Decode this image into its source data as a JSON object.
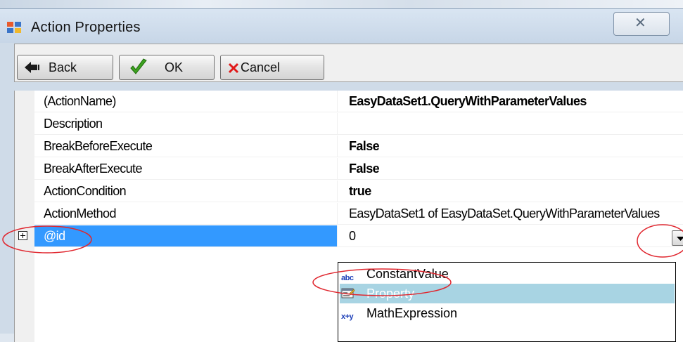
{
  "window": {
    "title": "Action Properties",
    "close_glyph": "✕"
  },
  "toolbar": {
    "back_label": "Back",
    "ok_label": "OK",
    "cancel_label": "Cancel",
    "back_icon": "arrow-left-icon",
    "ok_icon": "checkmark-icon",
    "cancel_icon": "x-icon"
  },
  "properties": [
    {
      "name": "(ActionName)",
      "value": "EasyDataSet1.QueryWithParameterValues",
      "bold": true
    },
    {
      "name": "Description",
      "value": "",
      "bold": false
    },
    {
      "name": "BreakBeforeExecute",
      "value": "False",
      "bold": true
    },
    {
      "name": "BreakAfterExecute",
      "value": "False",
      "bold": true
    },
    {
      "name": "ActionCondition",
      "value": "true",
      "bold": true
    },
    {
      "name": "ActionMethod",
      "value": "EasyDataSet1 of EasyDataSet.QueryWithParameterValues",
      "bold": false
    },
    {
      "name": "@id",
      "value": "0",
      "bold": false,
      "selected": true,
      "expandable": true
    }
  ],
  "dropdown": {
    "items": [
      {
        "icon_text": "abc",
        "icon": "abc-icon",
        "label": "ConstantValue"
      },
      {
        "icon": "property-icon",
        "label": "Property",
        "highlighted": true
      },
      {
        "icon_text": "x+y",
        "icon": "math-icon",
        "label": "MathExpression"
      }
    ]
  },
  "colors": {
    "selection": "#3399ff",
    "highlight": "#a8d4e3",
    "annotation": "#e0262e"
  }
}
